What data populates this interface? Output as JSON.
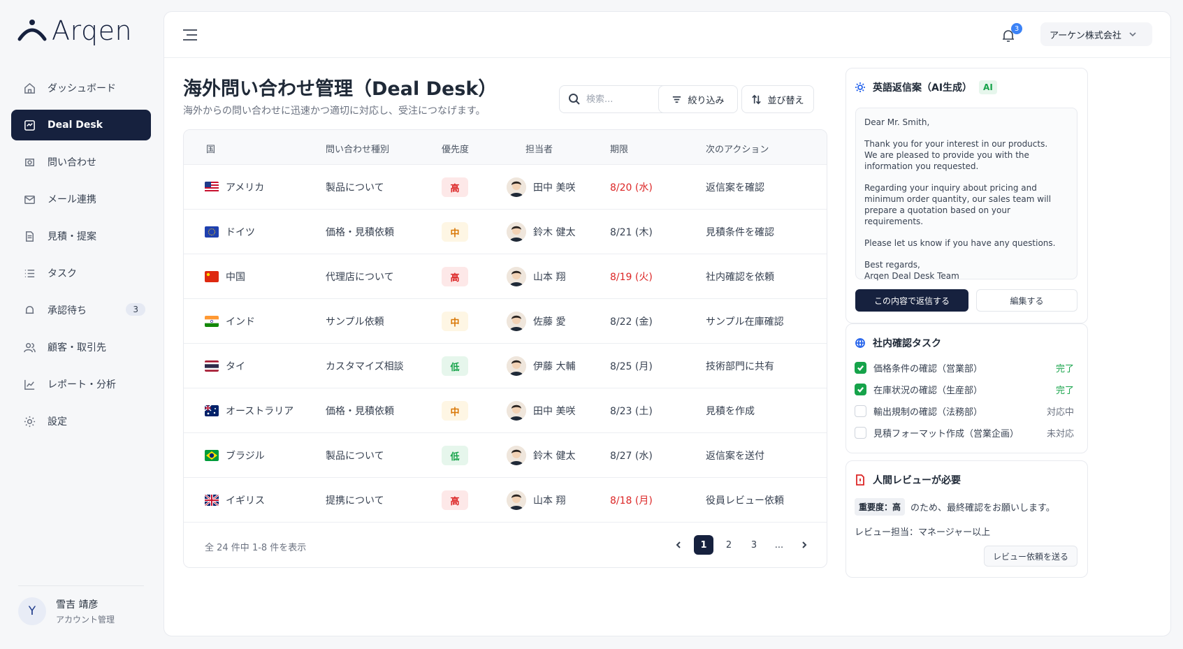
{
  "app": {
    "logo_text": "Arqen"
  },
  "sidebar": {
    "items": [
      {
        "label": "ダッシュボード",
        "icon": "home-icon"
      },
      {
        "label": "Deal Desk",
        "icon": "deal-icon"
      },
      {
        "label": "問い合わせ",
        "icon": "inquiry-icon"
      },
      {
        "label": "メール連携",
        "icon": "mail-icon"
      },
      {
        "label": "見積・提案",
        "icon": "document-icon"
      },
      {
        "label": "タスク",
        "icon": "list-icon"
      },
      {
        "label": "承認待ち",
        "icon": "bell-icon",
        "badge": "3"
      },
      {
        "label": "顧客・取引先",
        "icon": "users-icon"
      },
      {
        "label": "レポート・分析",
        "icon": "chart-icon"
      },
      {
        "label": "設定",
        "icon": "gear-icon"
      }
    ],
    "user": {
      "initial": "Y",
      "name": "雪吉 靖彦",
      "role": "アカウント管理"
    }
  },
  "topbar": {
    "notification_count": "3",
    "company": "アーケン株式会社"
  },
  "page": {
    "title": "海外問い合わせ管理（Deal Desk）",
    "subtitle": "海外からの問い合わせに迅速かつ適切に対応し、受注につなげます。"
  },
  "toolbar": {
    "search_placeholder": "検索...",
    "filter_label": "絞り込み",
    "sort_label": "並び替え"
  },
  "table": {
    "headers": [
      "国",
      "問い合わせ種別",
      "優先度",
      "担当者",
      "期限",
      "次のアクション"
    ],
    "rows": [
      {
        "country": "アメリカ",
        "flag": "us",
        "type": "製品について",
        "priority": "高",
        "level": "high",
        "owner": "田中 美咲",
        "due": "8/20 (水)",
        "overdue": true,
        "action": "返信案を確認"
      },
      {
        "country": "ドイツ",
        "flag": "eu",
        "type": "価格・見積依頼",
        "priority": "中",
        "level": "mid",
        "owner": "鈴木 健太",
        "due": "8/21 (木)",
        "overdue": false,
        "action": "見積条件を確認"
      },
      {
        "country": "中国",
        "flag": "cn",
        "type": "代理店について",
        "priority": "高",
        "level": "high",
        "owner": "山本 翔",
        "due": "8/19 (火)",
        "overdue": true,
        "action": "社内確認を依頼"
      },
      {
        "country": "インド",
        "flag": "in",
        "type": "サンプル依頼",
        "priority": "中",
        "level": "mid",
        "owner": "佐藤 愛",
        "due": "8/22 (金)",
        "overdue": false,
        "action": "サンプル在庫確認"
      },
      {
        "country": "タイ",
        "flag": "th",
        "type": "カスタマイズ相談",
        "priority": "低",
        "level": "low",
        "owner": "伊藤 大輔",
        "due": "8/25 (月)",
        "overdue": false,
        "action": "技術部門に共有"
      },
      {
        "country": "オーストラリア",
        "flag": "au",
        "type": "価格・見積依頼",
        "priority": "中",
        "level": "mid",
        "owner": "田中 美咲",
        "due": "8/23 (土)",
        "overdue": false,
        "action": "見積を作成"
      },
      {
        "country": "ブラジル",
        "flag": "br",
        "type": "製品について",
        "priority": "低",
        "level": "low",
        "owner": "鈴木 健太",
        "due": "8/27 (水)",
        "overdue": false,
        "action": "返信案を送付"
      },
      {
        "country": "イギリス",
        "flag": "gb",
        "type": "提携について",
        "priority": "高",
        "level": "high",
        "owner": "山本 翔",
        "due": "8/18 (月)",
        "overdue": true,
        "action": "役員レビュー依頼"
      }
    ],
    "count_text": "全 24 件中 1-8 件を表示",
    "pages": [
      "1",
      "2",
      "3",
      "..."
    ]
  },
  "reply_card": {
    "title": "英語返信案（AI生成）",
    "ai_tag": "AI",
    "paragraphs": [
      "Dear Mr. Smith,",
      "Thank you for your interest in our products.\nWe are pleased to provide you with the\ninformation you requested.",
      "Regarding your inquiry about pricing and\nminimum order quantity, our sales team will\nprepare a quotation based on your requirements.",
      "Please let us know if you have any questions.",
      "Best regards,\nArqen Deal Desk Team"
    ],
    "send_label": "この内容で返信する",
    "edit_label": "編集する"
  },
  "task_card": {
    "title": "社内確認タスク",
    "tasks": [
      {
        "label": "価格条件の確認（営業部）",
        "status": "完了",
        "done": true
      },
      {
        "label": "在庫状況の確認（生産部）",
        "status": "完了",
        "done": true
      },
      {
        "label": "輸出規制の確認（法務部）",
        "status": "対応中",
        "done": false
      },
      {
        "label": "見積フォーマット作成（営業企画）",
        "status": "未対応",
        "done": false
      }
    ]
  },
  "review_card": {
    "title": "人間レビューが必要",
    "importance_tag": "重要度：高",
    "importance_text": "のため、最終確認をお願いします。",
    "reviewer": "レビュー担当：マネージャー以上",
    "button_label": "レビュー依頼を送る"
  },
  "colors": {
    "primary": "#16213e",
    "danger": "#dc2626",
    "success": "#16a34a",
    "warning": "#d97706"
  }
}
